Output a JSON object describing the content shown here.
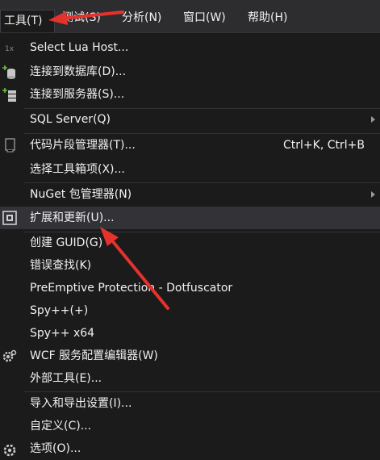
{
  "menubar": {
    "items": [
      {
        "label": "工具(T)"
      },
      {
        "label": "测试(S)"
      },
      {
        "label": "分析(N)"
      },
      {
        "label": "窗口(W)"
      },
      {
        "label": "帮助(H)"
      }
    ]
  },
  "menu": {
    "items": [
      {
        "label": "Select Lua Host...",
        "icon": "lua-icon"
      },
      {
        "label": "连接到数据库(D)...",
        "icon": "database-connect-icon"
      },
      {
        "label": "连接到服务器(S)...",
        "icon": "server-connect-icon"
      },
      {
        "label": "SQL Server(Q)",
        "submenu": true
      },
      {
        "label": "代码片段管理器(T)...",
        "shortcut": "Ctrl+K, Ctrl+B",
        "icon": "snippet-icon"
      },
      {
        "label": "选择工具箱项(X)..."
      },
      {
        "label": "NuGet 包管理器(N)",
        "submenu": true
      },
      {
        "label": "扩展和更新(U)...",
        "icon": "extensions-icon",
        "highlighted": true
      },
      {
        "label": "创建 GUID(G)"
      },
      {
        "label": "错误查找(K)"
      },
      {
        "label": "PreEmptive Protection - Dotfuscator"
      },
      {
        "label": "Spy++(+)"
      },
      {
        "label": "Spy++ x64"
      },
      {
        "label": "WCF 服务配置编辑器(W)",
        "icon": "wcf-gear-icon"
      },
      {
        "label": "外部工具(E)..."
      },
      {
        "label": "导入和导出设置(I)..."
      },
      {
        "label": "自定义(C)..."
      },
      {
        "label": "选项(O)...",
        "icon": "options-gear-icon"
      }
    ]
  },
  "colors": {
    "menu_background": "#1b1b1c",
    "menubar_background": "#2d2d30",
    "highlight": "#333337",
    "text": "#f1f1f1",
    "annotation_arrow": "#e5322d"
  }
}
